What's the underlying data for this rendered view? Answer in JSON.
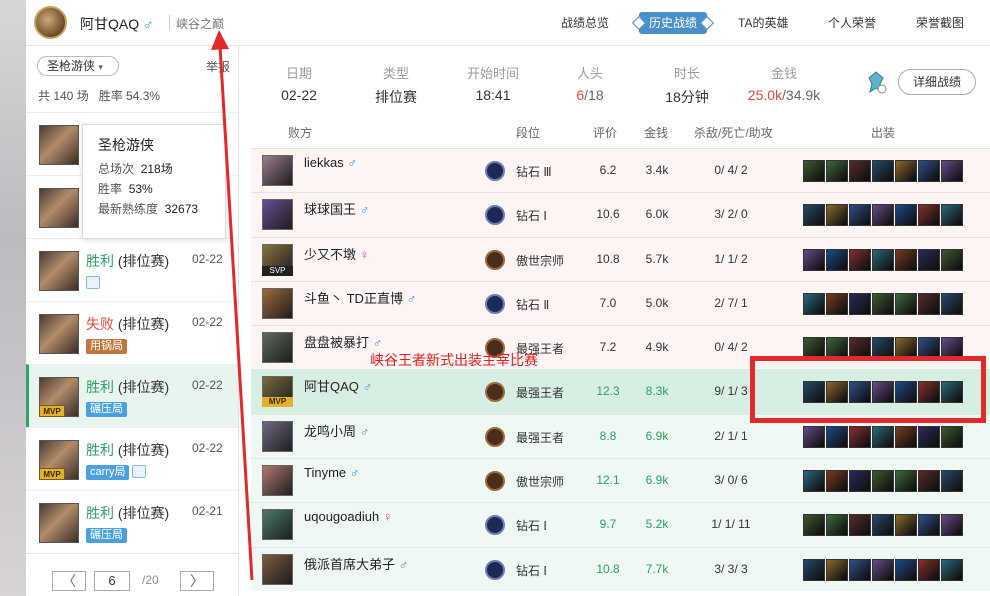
{
  "header": {
    "username": "阿甘QAQ",
    "gender_symbol": "♂",
    "server": "峡谷之巅",
    "nav": [
      "战绩总览",
      "历史战绩",
      "TA的英雄",
      "个人荣誉",
      "荣誉截图"
    ],
    "active_nav": "历史战绩"
  },
  "sidebar": {
    "hero_filter": "圣枪游侠",
    "report_label": "举报",
    "total_text": "共 140 场",
    "winrate_text": "胜率 54.3%",
    "tooltip": {
      "title": "圣枪游侠",
      "total_label": "总场次",
      "total_value": "218场",
      "winrate_label": "胜率",
      "winrate_value": "53%",
      "mastery_label": "最新熟练度",
      "mastery_value": "32673"
    },
    "matches": [
      {
        "result": "",
        "type": "",
        "date": "",
        "tag": "",
        "mvp": false
      },
      {
        "result": "",
        "type": "",
        "date": "",
        "tag": "",
        "mvp": false
      },
      {
        "result": "胜利",
        "type": "(排位赛)",
        "date": "02-22",
        "tag": "",
        "mvp": false
      },
      {
        "result": "失败",
        "type": "(排位赛)",
        "date": "02-22",
        "tag": "用锅局",
        "mvp": false
      },
      {
        "result": "胜利",
        "type": "(排位赛)",
        "date": "02-22",
        "tag": "碾压局",
        "mvp": true
      },
      {
        "result": "胜利",
        "type": "(排位赛)",
        "date": "02-22",
        "tag": "carry局",
        "mvp": true
      },
      {
        "result": "胜利",
        "type": "(排位赛)",
        "date": "02-21",
        "tag": "碾压局",
        "mvp": false
      }
    ],
    "pager": {
      "prev": "〈",
      "current": "6",
      "total": "/20",
      "next": "〉"
    }
  },
  "summary": {
    "date_label": "日期",
    "date": "02-22",
    "type_label": "类型",
    "type": "排位赛",
    "start_label": "开始时间",
    "start": "18:41",
    "kills_label": "人头",
    "kills_self": "6",
    "kills_total": "/18",
    "duration_label": "时长",
    "duration": "18分钟",
    "gold_label": "金钱",
    "gold_self": "25.0k",
    "gold_total": "/34.9k",
    "detail_button": "详细战绩"
  },
  "table": {
    "headers": {
      "team": "败方",
      "rank": "段位",
      "score": "评价",
      "gold": "金钱",
      "kda": "杀敌/死亡/助攻",
      "items": "出装"
    },
    "players": [
      {
        "name": "liekkas",
        "gender": "♂",
        "rank": "钻石 Ⅲ",
        "score": "6.2",
        "gold": "3.4k",
        "kda": "0/ 4/ 2",
        "team": "lose",
        "badge": ""
      },
      {
        "name": "球球国王",
        "gender": "♂",
        "rank": "钻石 Ⅰ",
        "score": "10.6",
        "gold": "6.0k",
        "kda": "3/ 2/ 0",
        "team": "lose",
        "badge": ""
      },
      {
        "name": "少又不墩",
        "gender": "♀",
        "rank": "傲世宗师",
        "score": "10.8",
        "gold": "5.7k",
        "kda": "1/ 1/ 2",
        "team": "lose",
        "badge": "SVP"
      },
      {
        "name": "斗鱼丶 TD正直博",
        "gender": "♂",
        "rank": "钻石 Ⅱ",
        "score": "7.0",
        "gold": "5.0k",
        "kda": "2/ 7/ 1",
        "team": "lose",
        "badge": ""
      },
      {
        "name": "盘盘被暴打",
        "gender": "♂",
        "rank": "最强王者",
        "score": "7.2",
        "gold": "4.9k",
        "kda": "0/ 4/ 2",
        "team": "lose",
        "badge": ""
      },
      {
        "name": "阿甘QAQ",
        "gender": "♂",
        "rank": "最强王者",
        "score": "12.3",
        "gold": "8.3k",
        "kda": "9/ 1/ 3",
        "team": "win",
        "badge": "MVP"
      },
      {
        "name": "龙鸣小周",
        "gender": "♂",
        "rank": "最强王者",
        "score": "8.8",
        "gold": "6.9k",
        "kda": "2/ 1/ 1",
        "team": "win",
        "badge": ""
      },
      {
        "name": "Tinyme",
        "gender": "♂",
        "rank": "傲世宗师",
        "score": "12.1",
        "gold": "6.9k",
        "kda": "3/ 0/ 6",
        "team": "win",
        "badge": ""
      },
      {
        "name": "uqougoadiuh",
        "gender": "♀",
        "rank": "钻石 Ⅰ",
        "score": "9.7",
        "gold": "5.2k",
        "kda": "1/ 1/ 11",
        "team": "win",
        "badge": ""
      },
      {
        "name": "俄派首席大弟子",
        "gender": "♂",
        "rank": "钻石 Ⅰ",
        "score": "10.8",
        "gold": "7.7k",
        "kda": "3/ 3/ 3",
        "team": "win",
        "badge": ""
      }
    ]
  },
  "annotation": {
    "text": "峡谷王者新式出装主宰比赛"
  },
  "colors": {
    "win": "#2e9f63",
    "lose": "#e04b3c",
    "accent": "#4a8fc9",
    "annotation": "#e02020"
  }
}
